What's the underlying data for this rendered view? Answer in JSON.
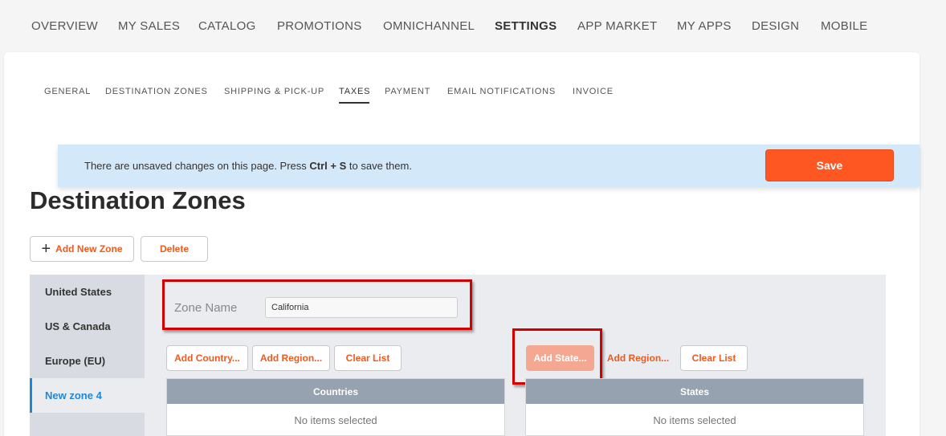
{
  "top_nav": {
    "items": [
      "OVERVIEW",
      "MY SALES",
      "CATALOG",
      "PROMOTIONS",
      "OMNICHANNEL",
      "SETTINGS",
      "APP MARKET",
      "MY APPS",
      "DESIGN",
      "MOBILE"
    ],
    "active": "SETTINGS"
  },
  "settings_tabs": {
    "items": [
      "GENERAL",
      "DESTINATION ZONES",
      "SHIPPING & PICK-UP",
      "TAXES",
      "PAYMENT",
      "EMAIL NOTIFICATIONS",
      "INVOICE"
    ],
    "active": "TAXES"
  },
  "banner": {
    "text_before": "There are unsaved changes on this page. Press ",
    "shortcut": "Ctrl + S",
    "text_after": " to save them.",
    "save_label": "Save"
  },
  "page": {
    "title": "Destination Zones",
    "add_zone_label": "Add New Zone",
    "delete_label": "Delete"
  },
  "zones": {
    "items": [
      "United States",
      "US & Canada",
      "Europe (EU)",
      "New zone 4"
    ],
    "active": "New zone 4"
  },
  "zone_form": {
    "name_label": "Zone Name",
    "name_value": "California"
  },
  "countries": {
    "add_country_label": "Add Country...",
    "add_region_label": "Add Region...",
    "clear_label": "Clear List",
    "header": "Countries",
    "empty_text": "No items selected"
  },
  "states": {
    "add_state_label": "Add State...",
    "add_region_label": "Add Region...",
    "clear_label": "Clear List",
    "header": "States",
    "empty_text": "No items selected"
  },
  "colors": {
    "accent": "#ff5722",
    "highlight": "#d40000",
    "active_link": "#1f87d8",
    "banner_bg": "#d3e8f8"
  }
}
